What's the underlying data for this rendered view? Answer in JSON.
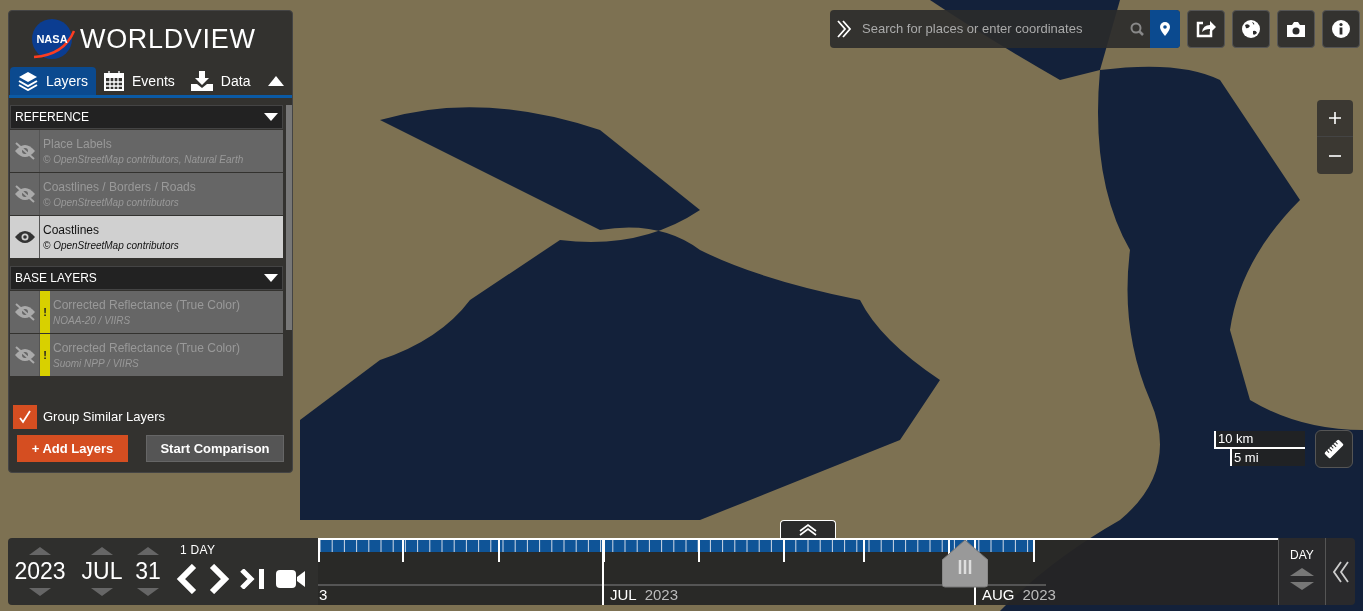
{
  "app": {
    "agency": "NASA",
    "title": "WORLDVIEW"
  },
  "tabs": [
    {
      "label": "Layers",
      "selected": true
    },
    {
      "label": "Events",
      "selected": false
    },
    {
      "label": "Data",
      "selected": false
    }
  ],
  "layer_groups": [
    {
      "title": "REFERENCE",
      "expanded": true,
      "layers": [
        {
          "name": "Place Labels",
          "source": "© OpenStreetMap contributors, Natural Earth",
          "visible": false
        },
        {
          "name": "Coastlines / Borders / Roads",
          "source": "© OpenStreetMap contributors",
          "visible": false
        },
        {
          "name": "Coastlines",
          "source": "© OpenStreetMap contributors",
          "visible": true
        }
      ]
    },
    {
      "title": "BASE LAYERS",
      "expanded": true,
      "layers": [
        {
          "name": "Corrected Reflectance (True Color)",
          "source": "NOAA-20 / VIIRS",
          "visible": false,
          "warning": "!"
        },
        {
          "name": "Corrected Reflectance (True Color)",
          "source": "Suomi NPP / VIIRS",
          "visible": false,
          "warning": "!"
        }
      ]
    }
  ],
  "group_similar": {
    "label": "Group Similar Layers",
    "checked": true
  },
  "buttons": {
    "add": "+ Add Layers",
    "compare": "Start Comparison"
  },
  "search": {
    "placeholder": "Search for places or enter coordinates"
  },
  "scale": {
    "metric": "10 km",
    "imperial": "5 mi"
  },
  "date": {
    "year": "2023",
    "month": "JUL",
    "day": "31",
    "interval": "1 DAY"
  },
  "timeline": {
    "labels": [
      {
        "month": "3"
      },
      {
        "month": "JUL",
        "year": "2023"
      },
      {
        "month": "AUG",
        "year": "2023"
      }
    ],
    "zoom": "DAY"
  }
}
